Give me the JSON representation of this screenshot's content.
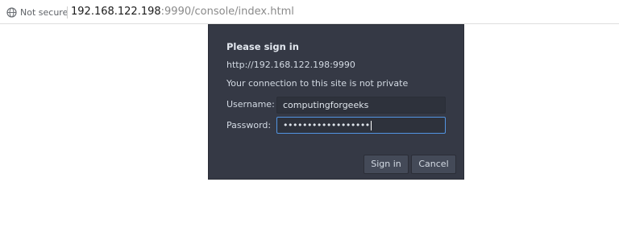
{
  "addressbar": {
    "security_icon": "globe-icon",
    "security_label": "Not secure",
    "url_host": "192.168.122.198",
    "url_rest": ":9990/console/index.html"
  },
  "dialog": {
    "title": "Please sign in",
    "origin": "http://192.168.122.198:9990",
    "warning": "Your connection to this site is not private",
    "username_label": "Username:",
    "username_value": "computingforgeeks",
    "password_label": "Password:",
    "password_value": "••••••••••••••••••",
    "signin_label": "Sign in",
    "cancel_label": "Cancel"
  },
  "colors": {
    "dialog_bg": "#353945",
    "focus_border": "#5294e2"
  }
}
